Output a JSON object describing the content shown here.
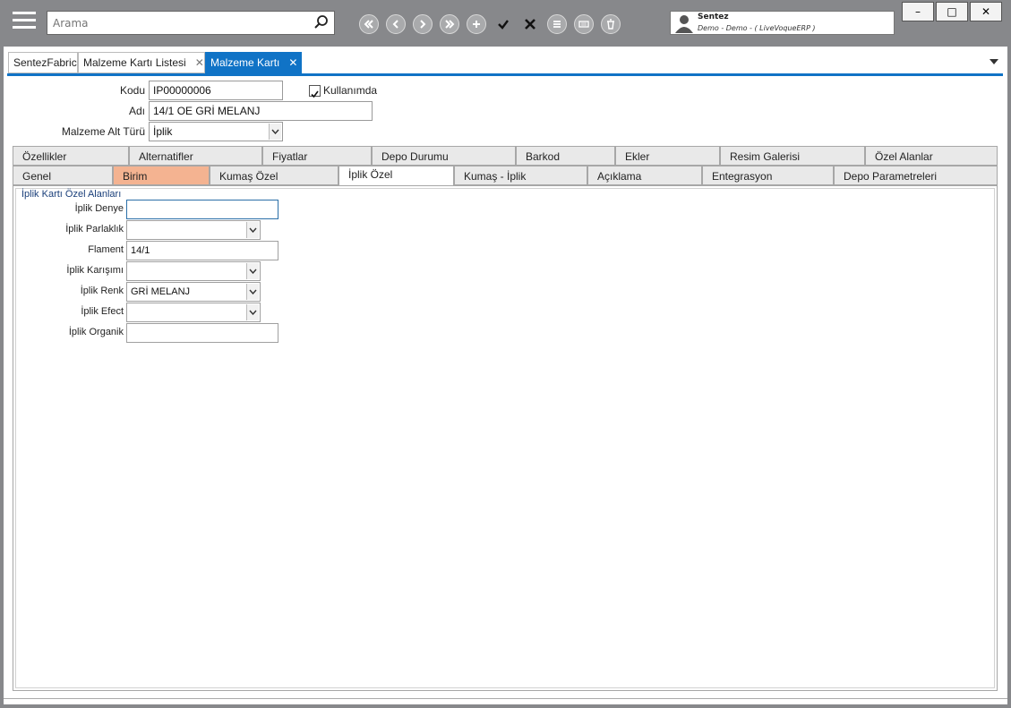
{
  "search": {
    "placeholder": "Arama"
  },
  "user": {
    "name": "Sentez",
    "subtitle": "Demo - Demo - ( LiveVoqueERP )"
  },
  "window_buttons": {
    "minimize": "–",
    "maximize": "□",
    "close": "✕"
  },
  "doc_tabs": [
    {
      "label": "SentezFabric"
    },
    {
      "label": "Malzeme Kartı Listesi",
      "close": "✕"
    },
    {
      "label": "Malzeme Kartı",
      "close": "✕"
    }
  ],
  "header": {
    "kodu_label": "Kodu",
    "kodu_value": "IP00000006",
    "kullanimda_label": "Kullanımda",
    "kullanimda_checked": true,
    "adi_label": "Adı",
    "adi_value": "14/1 OE GRİ MELANJ",
    "alt_turu_label": "Malzeme Alt Türü",
    "alt_turu_value": "İplik"
  },
  "tabs_row1": [
    "Özellikler",
    "Alternatifler",
    "Fiyatlar",
    "Depo Durumu",
    "Barkod",
    "Ekler",
    "Resim Galerisi",
    "Özel Alanlar"
  ],
  "tabs_row2": [
    "Genel",
    "Birim",
    "Kumaş Özel",
    "İplik Özel",
    "Kumaş - İplik",
    "Açıklama",
    "Entegrasyon",
    "Depo Parametreleri"
  ],
  "group": {
    "title": "İplik Kartı Özel Alanları",
    "fields": [
      {
        "label": "İplik Denye",
        "value": ""
      },
      {
        "label": "İplik Parlaklık",
        "value": ""
      },
      {
        "label": "Flament",
        "value": "14/1"
      },
      {
        "label": "İplik Karışımı",
        "value": ""
      },
      {
        "label": "İplik Renk",
        "value": "GRİ MELANJ"
      },
      {
        "label": "İplik Efect",
        "value": ""
      },
      {
        "label": "İplik Organik",
        "value": ""
      }
    ]
  },
  "colors": {
    "accent": "#1073c6",
    "toolbar": "#87888b",
    "highlight_tab": "#f4b391"
  }
}
